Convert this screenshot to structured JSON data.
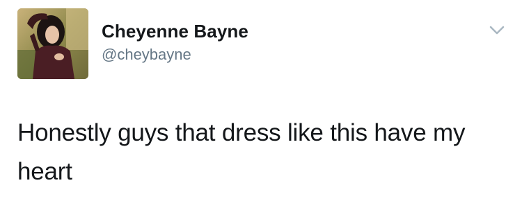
{
  "tweet": {
    "author": {
      "display_name": "Cheyenne Bayne",
      "handle": "@cheybayne",
      "avatar_icon": "profile-photo"
    },
    "menu_icon": "chevron-down-icon",
    "text": "Honestly guys that dress like this have my heart"
  },
  "colors": {
    "name": "#14171a",
    "handle": "#657786",
    "caret": "#aab8c2",
    "background": "#ffffff"
  }
}
